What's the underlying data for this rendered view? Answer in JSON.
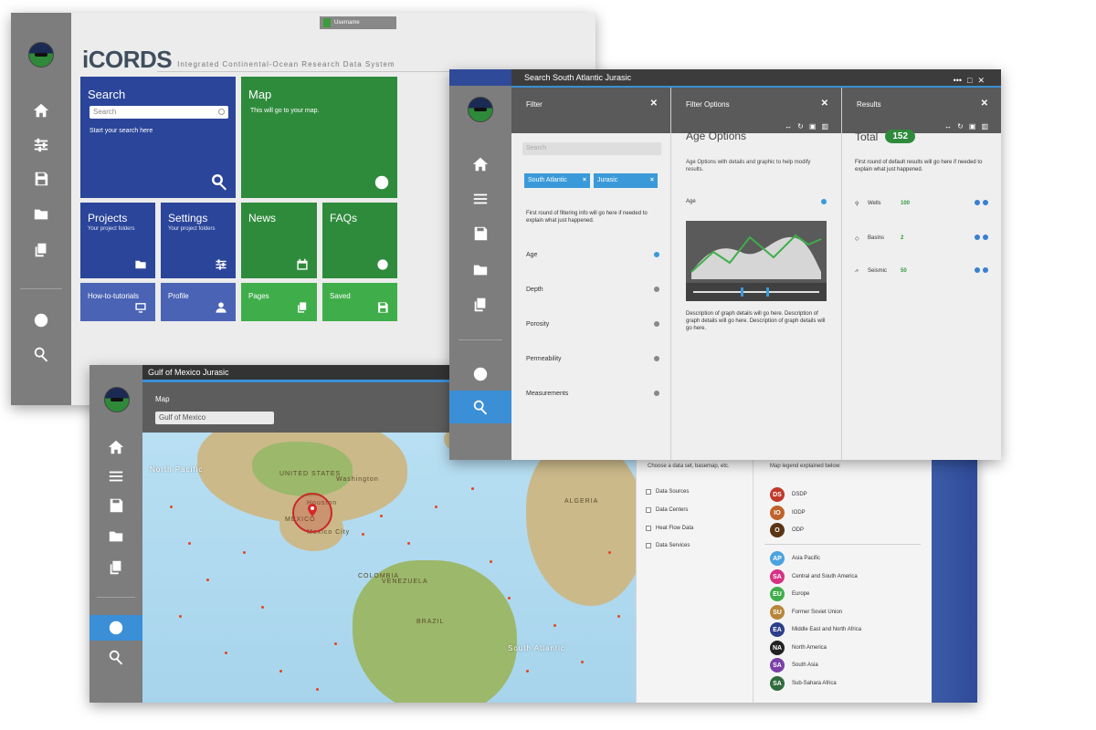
{
  "home": {
    "brand_name": "iCORDS",
    "brand_tagline": "Integrated Continental-Ocean Research Data System",
    "username": "Username",
    "tiles": {
      "search_title": "Search",
      "search_placeholder": "Search",
      "search_hint": "Start your search here",
      "map_title": "Map",
      "map_hint": "This will go to your map.",
      "projects_title": "Projects",
      "projects_sub": "Your project folders",
      "settings_title": "Settings",
      "settings_sub": "Your project folders",
      "news_title": "News",
      "faqs_title": "FAQs",
      "tutorials_title": "How-to-tutorials",
      "profile_title": "Profile",
      "pages_title": "Pages",
      "saved_title": "Saved"
    },
    "colors": {
      "blue_tile": "#2b459a",
      "light_blue_tile": "#4a63b5",
      "green_tile": "#2f8b3c",
      "light_green_tile": "#3fae4a"
    }
  },
  "map_window": {
    "title": "Gulf of Mexico Jurasic",
    "header_label": "Map",
    "search_value": "Gulf of Mexico",
    "map_labels": {
      "north_pacific": "North Pacific",
      "united_states": "UNITED STATES",
      "mexico": "MEXICO",
      "mexico_city": "Mexico City",
      "venezuela": "VENEZUELA",
      "colombia": "COLOMBIA",
      "brazil": "BRAZIL",
      "south_atlantic": "South Atlantic",
      "algeria": "ALGERIA",
      "houston": "Houston",
      "washington": "Washington"
    },
    "data_panel": {
      "header": "Choose a data set, basemap, etc.",
      "options": [
        "Data Sources",
        "Data Centers",
        "Heat Flow Data",
        "Data Services"
      ]
    },
    "legend_panel": {
      "header": "Map legend explained below:",
      "group1": [
        {
          "code": "DS",
          "label": "DSDP",
          "color": "#c0392b"
        },
        {
          "code": "IO",
          "label": "IODP",
          "color": "#c0622b"
        },
        {
          "code": "O",
          "label": "ODP",
          "color": "#5a3515"
        }
      ],
      "group2": [
        {
          "code": "AP",
          "label": "Asia Pacific",
          "color": "#4aa3df"
        },
        {
          "code": "SA",
          "label": "Central and South America",
          "color": "#d63384"
        },
        {
          "code": "EU",
          "label": "Europe",
          "color": "#3fae4a"
        },
        {
          "code": "SU",
          "label": "Former Soviet Union",
          "color": "#b8863b"
        },
        {
          "code": "EA",
          "label": "Middle East and North Africa",
          "color": "#2b3f8a"
        },
        {
          "code": "NA",
          "label": "North America",
          "color": "#222222"
        },
        {
          "code": "SA",
          "label": "South Asia",
          "color": "#7b3fa8"
        },
        {
          "code": "SA",
          "label": "Sub-Sahara Africa",
          "color": "#2f6b3c"
        }
      ]
    }
  },
  "search_window": {
    "title": "Search South Atlantic Jurasic",
    "controls": {
      "more": "•••",
      "maximize": "□",
      "close": "✕"
    },
    "filter": {
      "header": "Filter",
      "search_placeholder": "Search",
      "chips": [
        "South Atlantic",
        "Jurasic"
      ],
      "note": "First round of filtering info will go here if needed to explain what just happened.",
      "rows": [
        "Age",
        "Depth",
        "Porosity",
        "Permeability",
        "Measurements"
      ]
    },
    "filter_options": {
      "header": "Filter Options",
      "title": "Age Options",
      "note": "Age Options with details and graphic to help modify results.",
      "age_label": "Age",
      "description": "Description of graph details will go here. Description of graph details will go here. Description of graph details will go here."
    },
    "results": {
      "header": "Results",
      "total_label": "Total",
      "total_value": "152",
      "note": "First round of default results will go here if needed to explain what just happened.",
      "rows": [
        {
          "name": "Wells",
          "value": "100"
        },
        {
          "name": "Basins",
          "value": "2"
        },
        {
          "name": "Seismic",
          "value": "50"
        }
      ]
    }
  }
}
